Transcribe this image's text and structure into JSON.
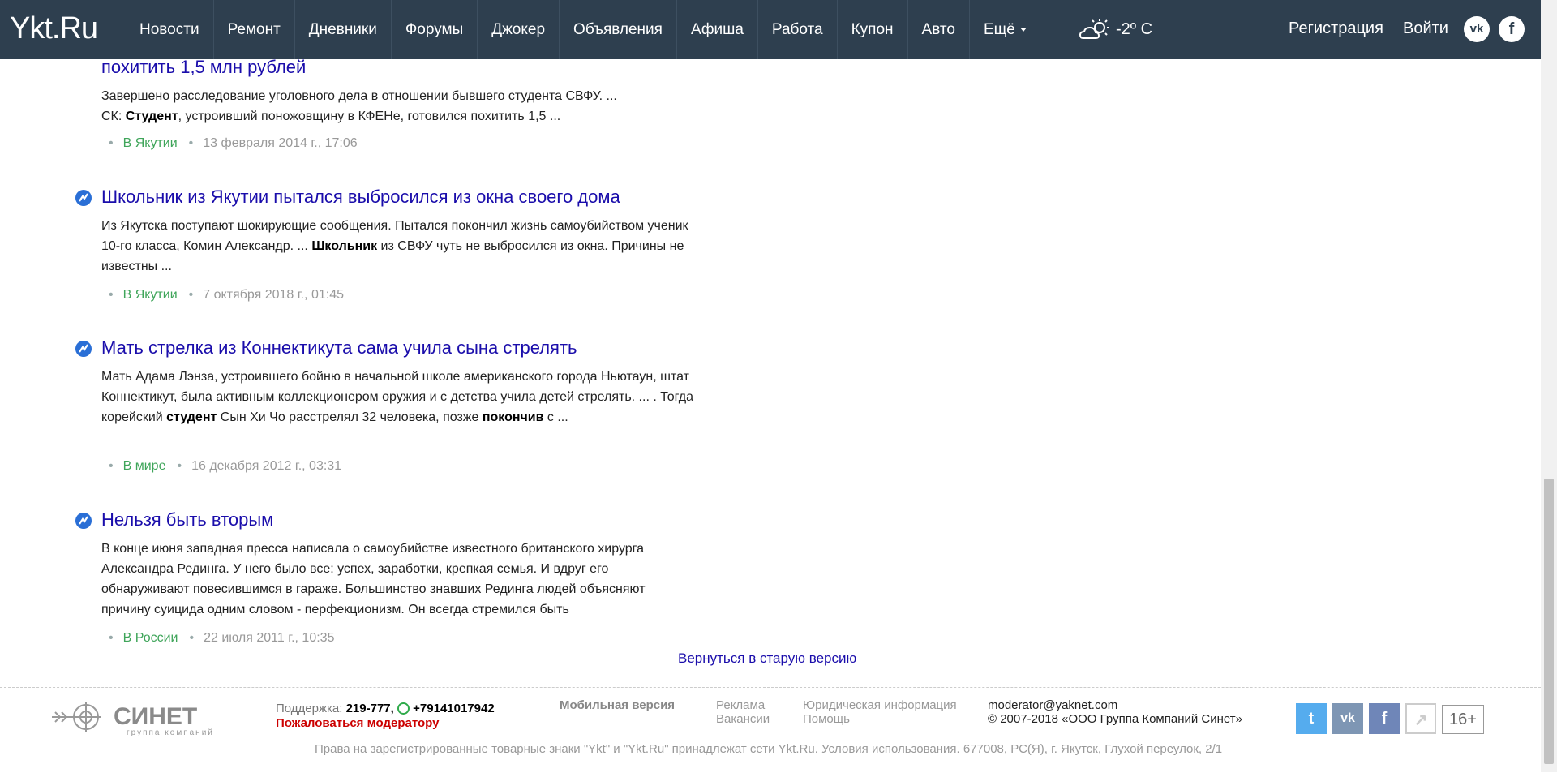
{
  "header": {
    "logo": "Ykt.Ru",
    "nav": [
      "Новости",
      "Ремонт",
      "Дневники",
      "Форумы",
      "Джокер",
      "Объявления",
      "Афиша",
      "Работа",
      "Купон",
      "Авто",
      "Ещё"
    ],
    "weather": "-2º C",
    "register": "Регистрация",
    "login": "Войти",
    "vk_icon": "vk-icon",
    "fb_icon": "facebook-icon"
  },
  "results": [
    {
      "title": "похитить 1,5 млн рублей",
      "snippet_html": "Завершено расследование уголовного дела в отношении бывшего студента СВФУ. ...<br>СК: <b>Студент</b>, устроивший поножовщину в КФЕНе, готовился похитить 1,5 ...",
      "section": "В Якутии",
      "date": "13 февраля 2014 г., 17:06"
    },
    {
      "title": "Школьник из Якутии пытался выбросился из окна своего дома",
      "snippet_html": "Из Якутска поступают шокирующие сообщения. Пытался покончил жизнь самоубийством ученик 10-го класса, Комин Александр. ... <b>Школьник</b> из СВФУ чуть не выбросился из окна. Причины не известны ...",
      "section": "В Якутии",
      "date": "7 октября 2018 г., 01:45"
    },
    {
      "title": "Мать стрелка из Коннектикута сама учила сына стрелять",
      "snippet_html": "Мать Адама Лэнза, устроившего бойню в начальной школе американского города Ньютаун, штат Коннектикут, была активным коллекционером оружия и с детства учила детей стрелять. ... . Тогда корейский <b>студент</b> Сын Хи Чо расстрелял 32 человека, позже <b>покончив</b> с ...",
      "section": "В мире",
      "date": "16 декабря 2012 г., 03:31"
    },
    {
      "title": "Нельзя быть вторым",
      "snippet_html": "В конце июня западная пресса написала о самоубийстве известного британского хирурга Александра Рединга. У него было все: успех, заработки, крепкая семья. И вдруг его обнаруживают повесившимся в гараже. Большинство знавших Рединга людей объясняют причину суицида одним словом - перфекционизм. Он всегда стремился быть",
      "section": "В России",
      "date": "22 июля 2011 г., 10:35"
    }
  ],
  "old_version": "Вернуться в старую версию",
  "footer": {
    "logo_text": "СИНЕТ",
    "logo_sub": "группа компаний",
    "support_label": "Поддержка:",
    "support_phone": "219-777,",
    "support_mobile": "+79141017942",
    "complain": "Пожаловаться модератору",
    "mobile": "Мобильная версия",
    "ads": "Реклама",
    "vacancies": "Вакансии",
    "legal": "Юридическая информация",
    "help": "Помощь",
    "email": "moderator@yaknet.com",
    "copyright": "© 2007-2018 «ООО Группа Компаний Синет»",
    "age": "16+",
    "rights": "Права на зарегистрированные товарные знаки \"Ykt\" и \"Ykt.Ru\" принадлежат сети Ykt.Ru. Условия использования. 677008, РС(Я), г. Якутск, Глухой переулок, 2/1"
  },
  "colors": {
    "header_bg": "#2e3f4f",
    "link": "#1a0dab",
    "section": "#3fa55a",
    "twitter": "#55acee",
    "vk": "#7e96b4",
    "facebook": "#6f86b8"
  }
}
